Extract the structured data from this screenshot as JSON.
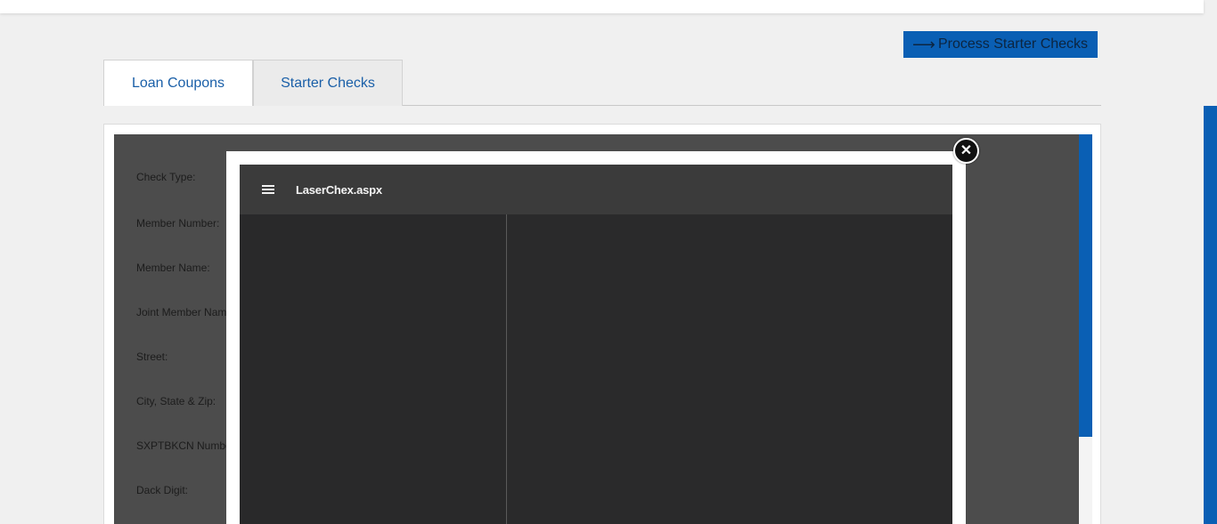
{
  "header": {
    "process_button_label": "Process Starter Checks",
    "process_button_icon": "arrow-right-icon"
  },
  "tabs": [
    {
      "label": "Loan Coupons",
      "active": false
    },
    {
      "label": "Starter Checks",
      "active": true
    }
  ],
  "form": {
    "fields": [
      {
        "label": "Check Type:"
      },
      {
        "label": "Member Number:"
      },
      {
        "label": "Member Name:"
      },
      {
        "label": "Joint Member Name:"
      },
      {
        "label": "Street:"
      },
      {
        "label": "City, State & Zip:"
      },
      {
        "label": "SXPTBKCN Number:"
      },
      {
        "label": "Dack Digit:"
      }
    ]
  },
  "modal": {
    "viewer_title": "LaserChex.aspx",
    "menu_icon": "hamburger-menu-icon",
    "close_icon": "close-icon"
  },
  "colors": {
    "accent": "#0a5fb4",
    "tab_text": "#1a5fa8",
    "overlay": "#4c4c4c",
    "viewer_toolbar": "#3b3b3b",
    "viewer_bg": "#2a2a2b"
  }
}
